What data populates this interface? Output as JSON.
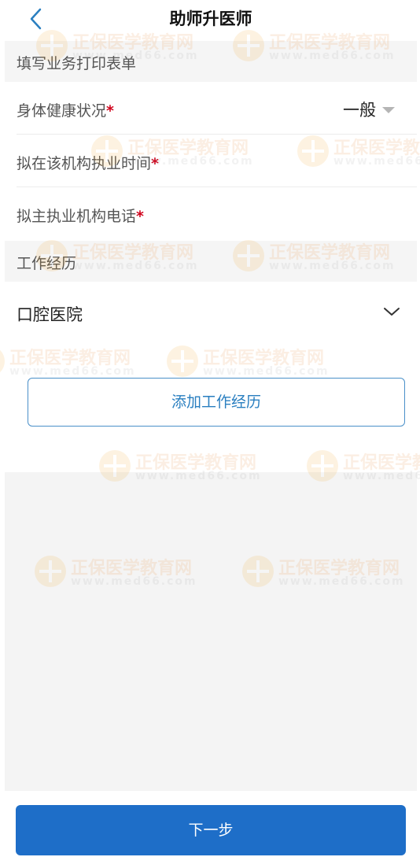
{
  "nav": {
    "title": "助师升医师"
  },
  "sections": {
    "print_form": "填写业务打印表单",
    "work_history": "工作经历"
  },
  "form": {
    "health": {
      "label": "身体健康状况",
      "value": "一般"
    },
    "practice_time": {
      "label": "拟在该机构执业时间"
    },
    "phone": {
      "label": "拟主执业机构电话"
    },
    "required_mark": "*"
  },
  "work": {
    "item_label": "口腔医院"
  },
  "buttons": {
    "add_work": "添加工作经历",
    "next": "下一步"
  },
  "watermark": {
    "text": "正保医学教育网",
    "url": "www.med66.com"
  },
  "colors": {
    "primary": "#1e6ec8",
    "required": "#d0021b",
    "watermark": "#e67e22"
  }
}
